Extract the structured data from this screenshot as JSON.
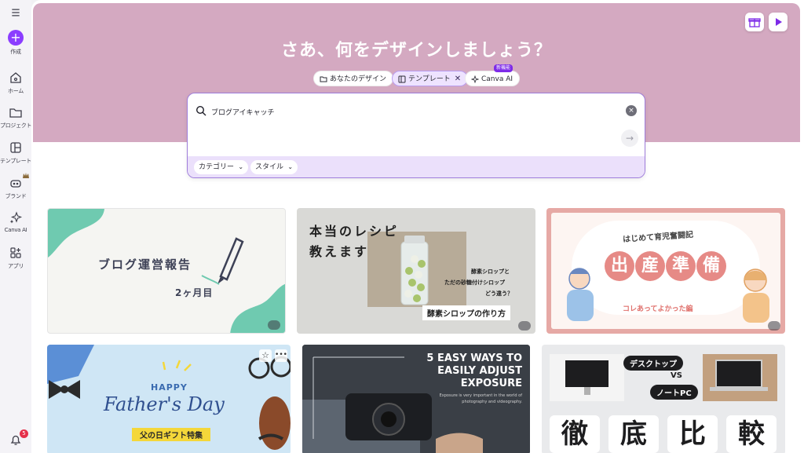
{
  "sidebar": {
    "menu_icon": "hamburger-icon",
    "items": [
      {
        "label": "作成",
        "icon": "plus-icon"
      },
      {
        "label": "ホーム",
        "icon": "home-icon"
      },
      {
        "label": "プロジェクト",
        "icon": "folder-icon"
      },
      {
        "label": "テンプレート",
        "icon": "template-icon"
      },
      {
        "label": "ブランド",
        "icon": "brand-icon"
      },
      {
        "label": "Canva AI",
        "icon": "sparkle-icon"
      },
      {
        "label": "アプリ",
        "icon": "apps-icon"
      }
    ],
    "notifications_count": "5"
  },
  "hero": {
    "title": "さあ、何をデザインしましょう？",
    "background_color": "#d4a9c1",
    "chips": [
      {
        "label": "あなたのデザイン",
        "icon": "folder-icon"
      },
      {
        "label": "テンプレート",
        "icon": "template-icon",
        "active": true,
        "close": "✕"
      },
      {
        "label": "Canva AI",
        "icon": "sparkle-icon",
        "badge": "新機能"
      }
    ]
  },
  "search": {
    "value": "ブログアイキャッチ",
    "clear": "×",
    "submit": "→",
    "filters": [
      {
        "label": "カテゴリー",
        "chevron": "⌄"
      },
      {
        "label": "スタイル",
        "chevron": "⌄"
      }
    ]
  },
  "templates": [
    {
      "title": "ブログ運営報告",
      "subtitle": "2ヶ月目",
      "accent": "#6fcab0",
      "premium": true
    },
    {
      "title_line1": "本当のレシピ",
      "title_line2": "教えます",
      "note_line1": "酵素シロップと",
      "note_line2": "ただの砂糖付けシロップ",
      "note_line3": "どう違う？",
      "caption": "酵素シロップの作り方",
      "premium": true
    },
    {
      "title": "はじめて育児奮闘記",
      "big_chars": [
        "出",
        "産",
        "準",
        "備"
      ],
      "caption": "コレあってよかった編",
      "accent": "#e38b8b",
      "premium": true
    },
    {
      "line1": "HAPPY",
      "line2": "Father's Day",
      "caption": "父の日ギフト特集",
      "accent": "#f4d73a"
    },
    {
      "line1": "5 EASY WAYS TO",
      "line2": "EASILY ADJUST",
      "line3": "EXPOSURE",
      "body1": "Exposure is very important in the world of",
      "body2": "photography and videography."
    },
    {
      "label1": "デスクトップ",
      "vs": "VS",
      "label2": "ノートPC",
      "big_chars": [
        "徹",
        "底",
        "比",
        "較"
      ]
    }
  ]
}
